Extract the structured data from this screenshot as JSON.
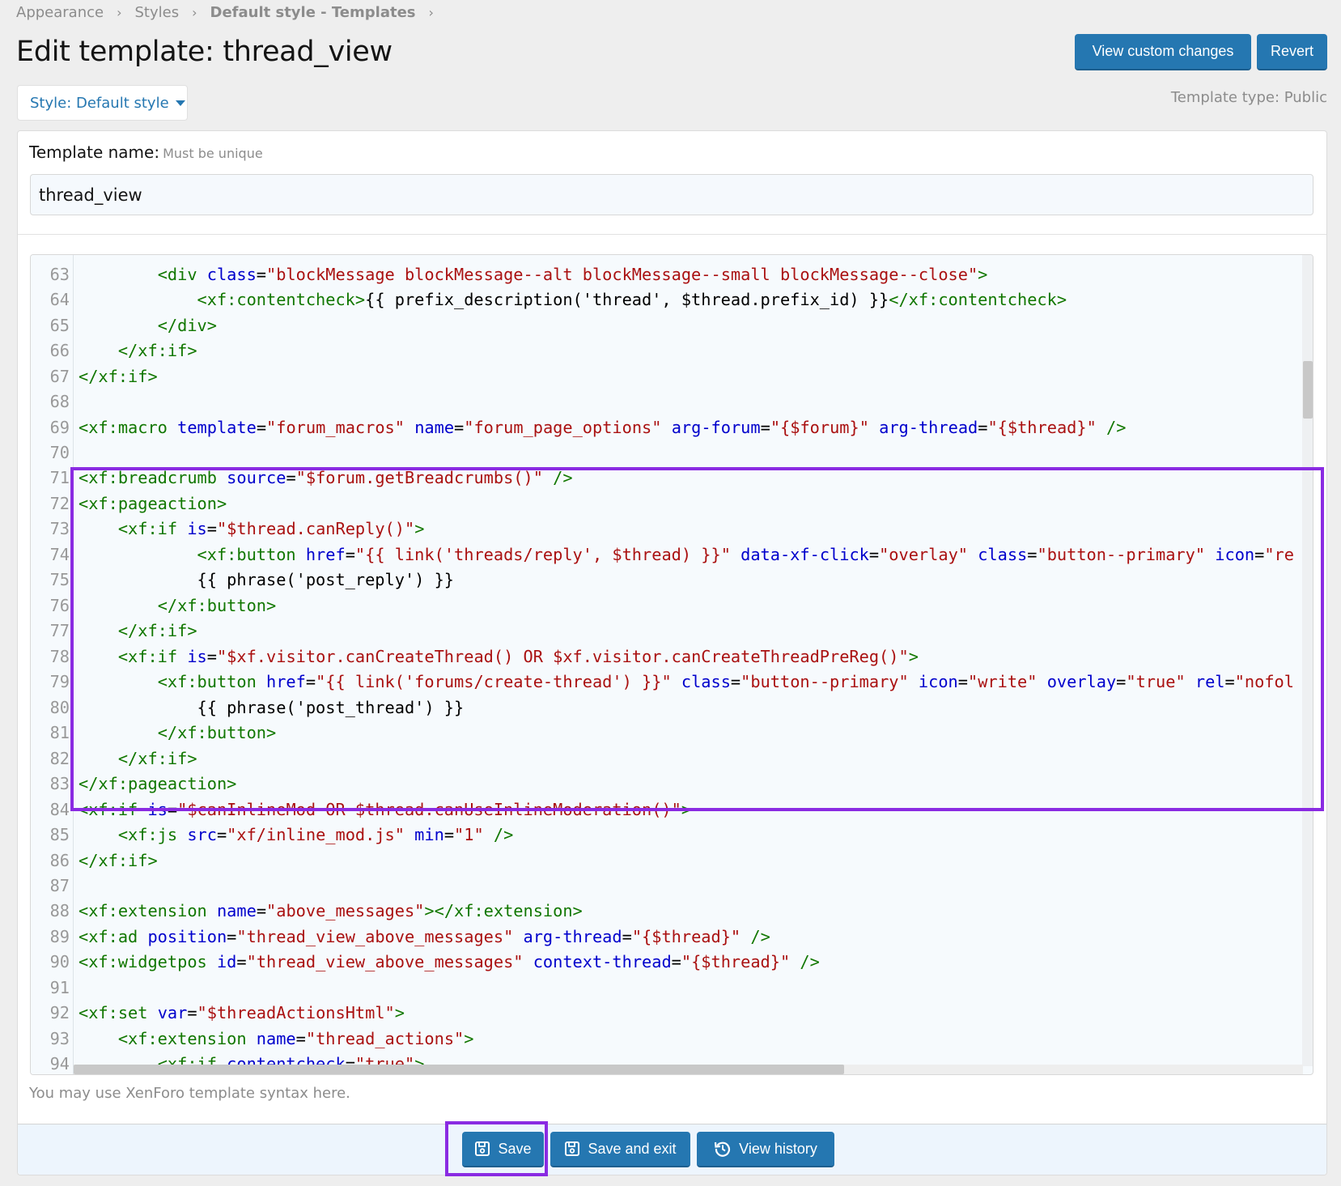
{
  "breadcrumb": [
    "Appearance",
    "Styles",
    "Default style - Templates"
  ],
  "page_title": "Edit template: thread_view",
  "header_buttons": {
    "view_custom_changes": "View custom changes",
    "revert": "Revert"
  },
  "style_selector": "Style: Default style",
  "template_type": "Template type: Public",
  "template_name": {
    "label": "Template name:",
    "hint": "Must be unique",
    "value": "thread_view"
  },
  "editor_hint": "You may use XenForo template syntax here.",
  "footer_buttons": {
    "save": "Save",
    "save_exit": "Save and exit",
    "view_history": "View history"
  },
  "colors": {
    "primary": "#2577b1",
    "tag": "#117700",
    "attribute": "#0000cc",
    "string": "#aa1111",
    "highlight": "#8a2be2"
  },
  "icons": {
    "save": "floppy-disk-icon",
    "history": "history-icon",
    "caret": "caret-down-icon"
  },
  "code_lines": [
    {
      "n": "63",
      "t": [
        [
          "p",
          "        "
        ],
        [
          "t",
          "<div"
        ],
        [
          "a",
          " class="
        ],
        [
          "s",
          "\"blockMessage blockMessage--alt blockMessage--small blockMessage--close\""
        ],
        [
          "t",
          ">"
        ]
      ]
    },
    {
      "n": "64",
      "t": [
        [
          "p",
          "            "
        ],
        [
          "t",
          "<xf:contentcheck>"
        ],
        [
          "p",
          "{{ prefix_description('thread', $thread.prefix_id) }}"
        ],
        [
          "t",
          "</xf:contentcheck>"
        ]
      ]
    },
    {
      "n": "65",
      "t": [
        [
          "p",
          "        "
        ],
        [
          "t",
          "</div>"
        ]
      ]
    },
    {
      "n": "66",
      "t": [
        [
          "p",
          "    "
        ],
        [
          "t",
          "</xf:if>"
        ]
      ]
    },
    {
      "n": "67",
      "t": [
        [
          "t",
          "</xf:if>"
        ]
      ]
    },
    {
      "n": "68",
      "t": []
    },
    {
      "n": "69",
      "t": [
        [
          "t",
          "<xf:macro"
        ],
        [
          "a",
          " template="
        ],
        [
          "s",
          "\"forum_macros\""
        ],
        [
          "a",
          " name="
        ],
        [
          "s",
          "\"forum_page_options\""
        ],
        [
          "a",
          " arg-forum="
        ],
        [
          "s",
          "\"{$forum}\""
        ],
        [
          "a",
          " arg-thread="
        ],
        [
          "s",
          "\"{$thread}\""
        ],
        [
          "t",
          " />"
        ]
      ]
    },
    {
      "n": "70",
      "t": []
    },
    {
      "n": "71",
      "t": [
        [
          "t",
          "<xf:breadcrumb"
        ],
        [
          "a",
          " source="
        ],
        [
          "s",
          "\"$forum.getBreadcrumbs()\""
        ],
        [
          "t",
          " />"
        ]
      ]
    },
    {
      "n": "72",
      "t": [
        [
          "t",
          "<xf:pageaction>"
        ]
      ]
    },
    {
      "n": "73",
      "t": [
        [
          "p",
          "    "
        ],
        [
          "t",
          "<xf:if"
        ],
        [
          "a",
          " is="
        ],
        [
          "s",
          "\"$thread.canReply()\""
        ],
        [
          "t",
          ">"
        ]
      ]
    },
    {
      "n": "74",
      "t": [
        [
          "p",
          "            "
        ],
        [
          "t",
          "<xf:button"
        ],
        [
          "a",
          " href="
        ],
        [
          "s",
          "\"{{ link('threads/reply', $thread) }}\""
        ],
        [
          "a",
          " data-xf-click="
        ],
        [
          "s",
          "\"overlay\""
        ],
        [
          "a",
          " class="
        ],
        [
          "s",
          "\"button--primary\""
        ],
        [
          "a",
          " icon="
        ],
        [
          "s",
          "\"re"
        ]
      ]
    },
    {
      "n": "75",
      "t": [
        [
          "p",
          "            {{ phrase('post_reply') }}"
        ]
      ]
    },
    {
      "n": "76",
      "t": [
        [
          "p",
          "        "
        ],
        [
          "t",
          "</xf:button>"
        ]
      ]
    },
    {
      "n": "77",
      "t": [
        [
          "p",
          "    "
        ],
        [
          "t",
          "</xf:if>"
        ]
      ]
    },
    {
      "n": "78",
      "t": [
        [
          "p",
          "    "
        ],
        [
          "t",
          "<xf:if"
        ],
        [
          "a",
          " is="
        ],
        [
          "s",
          "\"$xf.visitor.canCreateThread() OR $xf.visitor.canCreateThreadPreReg()\""
        ],
        [
          "t",
          ">"
        ]
      ]
    },
    {
      "n": "79",
      "t": [
        [
          "p",
          "        "
        ],
        [
          "t",
          "<xf:button"
        ],
        [
          "a",
          " href="
        ],
        [
          "s",
          "\"{{ link('forums/create-thread') }}\""
        ],
        [
          "a",
          " class="
        ],
        [
          "s",
          "\"button--primary\""
        ],
        [
          "a",
          " icon="
        ],
        [
          "s",
          "\"write\""
        ],
        [
          "a",
          " overlay="
        ],
        [
          "s",
          "\"true\""
        ],
        [
          "a",
          " rel="
        ],
        [
          "s",
          "\"nofol"
        ]
      ]
    },
    {
      "n": "80",
      "t": [
        [
          "p",
          "            {{ phrase('post_thread') }}"
        ]
      ]
    },
    {
      "n": "81",
      "t": [
        [
          "p",
          "        "
        ],
        [
          "t",
          "</xf:button>"
        ]
      ]
    },
    {
      "n": "82",
      "t": [
        [
          "p",
          "    "
        ],
        [
          "t",
          "</xf:if>"
        ]
      ]
    },
    {
      "n": "83",
      "t": [
        [
          "t",
          "</xf:pageaction>"
        ]
      ]
    },
    {
      "n": "84",
      "t": [
        [
          "t",
          "<xf:if"
        ],
        [
          "a",
          " is="
        ],
        [
          "s",
          "\"$canInlineMod OR $thread.canUseInlineModeration()\""
        ],
        [
          "t",
          ">"
        ]
      ]
    },
    {
      "n": "85",
      "t": [
        [
          "p",
          "    "
        ],
        [
          "t",
          "<xf:js"
        ],
        [
          "a",
          " src="
        ],
        [
          "s",
          "\"xf/inline_mod.js\""
        ],
        [
          "a",
          " min="
        ],
        [
          "s",
          "\"1\""
        ],
        [
          "t",
          " />"
        ]
      ]
    },
    {
      "n": "86",
      "t": [
        [
          "t",
          "</xf:if>"
        ]
      ]
    },
    {
      "n": "87",
      "t": []
    },
    {
      "n": "88",
      "t": [
        [
          "t",
          "<xf:extension"
        ],
        [
          "a",
          " name="
        ],
        [
          "s",
          "\"above_messages\""
        ],
        [
          "t",
          "></xf:extension>"
        ]
      ]
    },
    {
      "n": "89",
      "t": [
        [
          "t",
          "<xf:ad"
        ],
        [
          "a",
          " position="
        ],
        [
          "s",
          "\"thread_view_above_messages\""
        ],
        [
          "a",
          " arg-thread="
        ],
        [
          "s",
          "\"{$thread}\""
        ],
        [
          "t",
          " />"
        ]
      ]
    },
    {
      "n": "90",
      "t": [
        [
          "t",
          "<xf:widgetpos"
        ],
        [
          "a",
          " id="
        ],
        [
          "s",
          "\"thread_view_above_messages\""
        ],
        [
          "a",
          " context-thread="
        ],
        [
          "s",
          "\"{$thread}\""
        ],
        [
          "t",
          " />"
        ]
      ]
    },
    {
      "n": "91",
      "t": []
    },
    {
      "n": "92",
      "t": [
        [
          "t",
          "<xf:set"
        ],
        [
          "a",
          " var="
        ],
        [
          "s",
          "\"$threadActionsHtml\""
        ],
        [
          "t",
          ">"
        ]
      ]
    },
    {
      "n": "93",
      "t": [
        [
          "p",
          "    "
        ],
        [
          "t",
          "<xf:extension"
        ],
        [
          "a",
          " name="
        ],
        [
          "s",
          "\"thread_actions\""
        ],
        [
          "t",
          ">"
        ]
      ]
    },
    {
      "n": "94",
      "t": [
        [
          "p",
          "        "
        ],
        [
          "t",
          "<xf:if"
        ],
        [
          "a",
          " contentcheck="
        ],
        [
          "s",
          "\"true\""
        ],
        [
          "t",
          ">"
        ]
      ]
    }
  ]
}
